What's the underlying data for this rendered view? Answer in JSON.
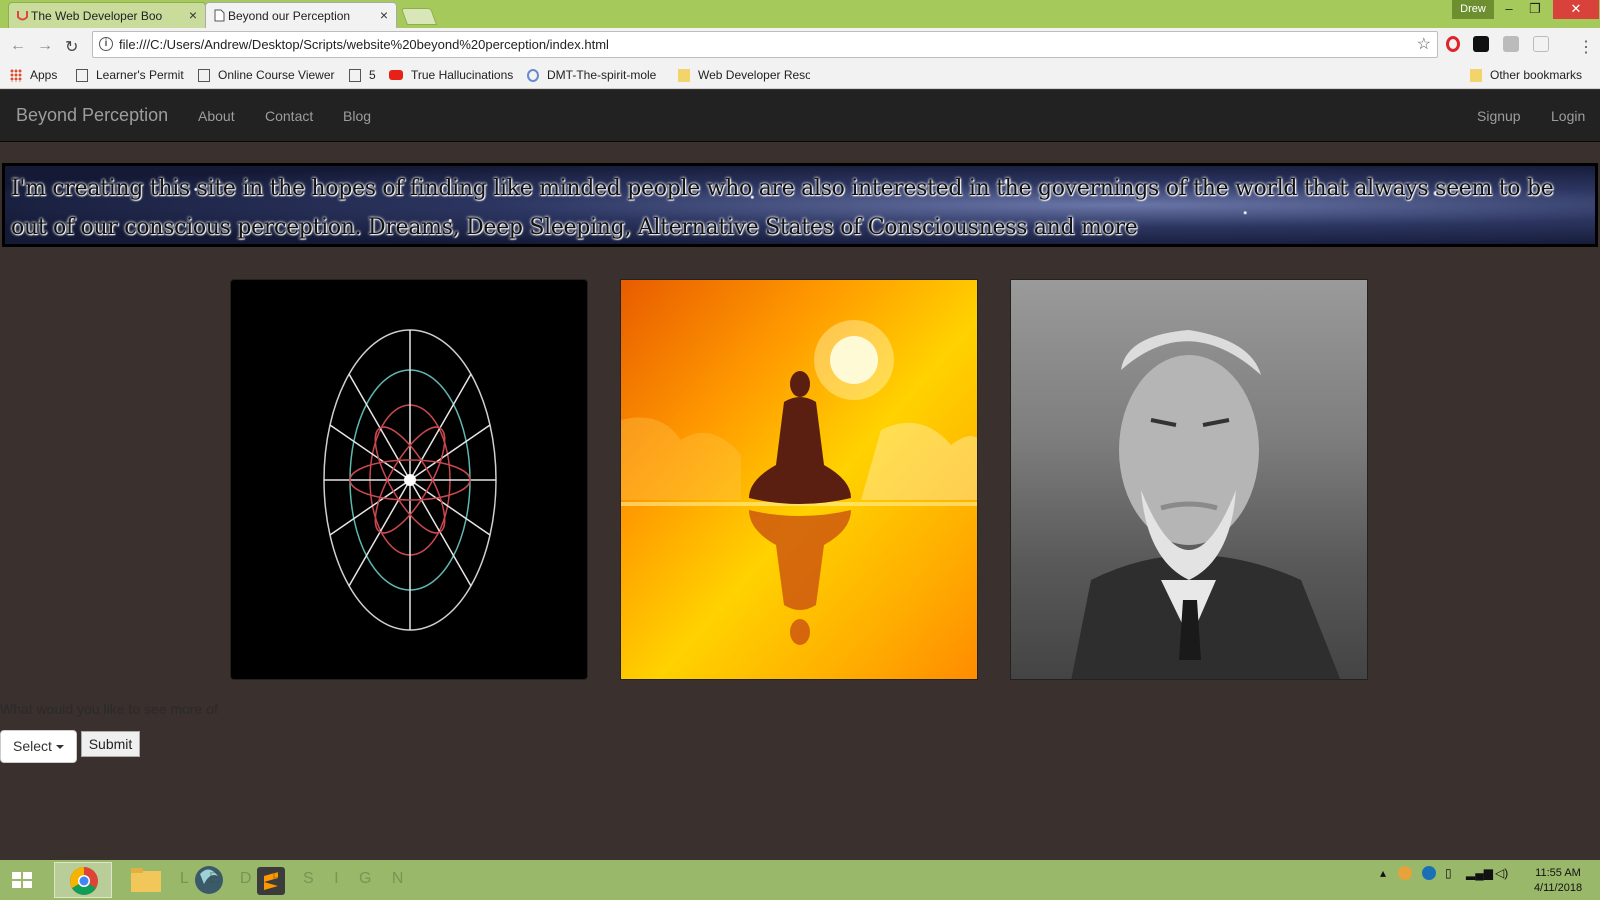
{
  "browser": {
    "tabs": [
      {
        "title": "The Web Developer Boo",
        "active": false
      },
      {
        "title": "Beyond our Perception",
        "active": true
      }
    ],
    "window_user": "Drew",
    "url": "file:///C:/Users/Andrew/Desktop/Scripts/website%20beyond%20perception/index.html",
    "bookmarks": [
      "Apps",
      "Learner's Permit",
      "Online Course Viewer",
      "5",
      "True Hallucinations",
      "DMT-The-spirit-mole",
      "Web Developer Reso"
    ],
    "other_bookmarks": "Other bookmarks"
  },
  "site": {
    "brand": "Beyond Perception",
    "nav_left": [
      "About",
      "Contact",
      "Blog"
    ],
    "nav_right": [
      "Signup",
      "Login"
    ],
    "banner_text": "I'm creating this site in the hopes of finding like minded people who are also interested in the governings of the world that always seem to be out of our conscious perception. Dreams, Deep Sleeping, Alternative States of Consciousness and more",
    "survey": {
      "question": "What would you like to see more of",
      "select_label": "Select",
      "submit_label": "Submit"
    }
  },
  "taskbar": {
    "watermark": "L E   D E S I G N",
    "time": "11:55 AM",
    "date": "4/11/2018"
  },
  "colors": {
    "page_bg": "#3a302d",
    "navbar_bg": "#222222",
    "tabstrip": "#a5c95a",
    "taskbar": "#9ab86a"
  }
}
